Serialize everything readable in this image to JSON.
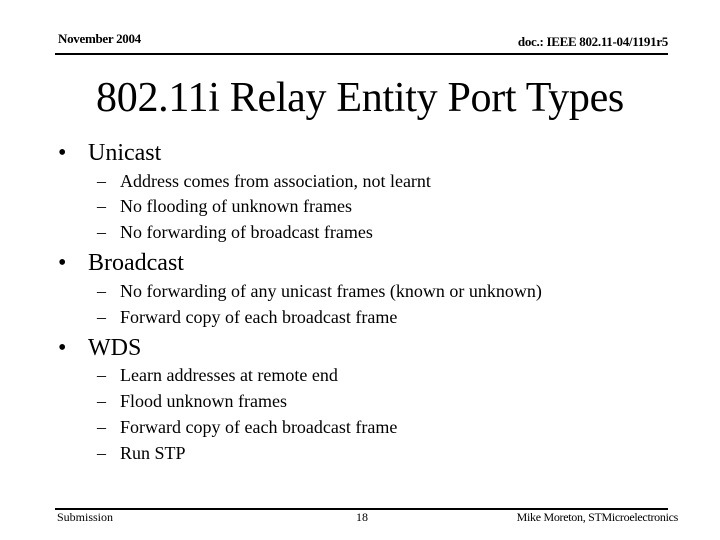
{
  "header": {
    "date": "November 2004",
    "doc_id": "doc.: IEEE 802.11-04/1191r5"
  },
  "slide": {
    "title": "802.11i Relay Entity Port Types",
    "bullets": [
      {
        "label": "Unicast",
        "sub": [
          "Address comes from association, not learnt",
          "No flooding of unknown frames",
          "No forwarding of broadcast frames"
        ]
      },
      {
        "label": "Broadcast",
        "sub": [
          "No forwarding of any unicast frames (known or unknown)",
          "Forward copy of each broadcast frame"
        ]
      },
      {
        "label": "WDS",
        "sub": [
          "Learn addresses at remote end",
          "Flood unknown frames",
          "Forward copy of each broadcast frame",
          "Run STP"
        ]
      }
    ],
    "bullet_glyph": "•",
    "dash_glyph": "–"
  },
  "footer": {
    "left": "Submission",
    "page_number": "18",
    "author": "Mike Moreton, STMicroelectronics"
  }
}
